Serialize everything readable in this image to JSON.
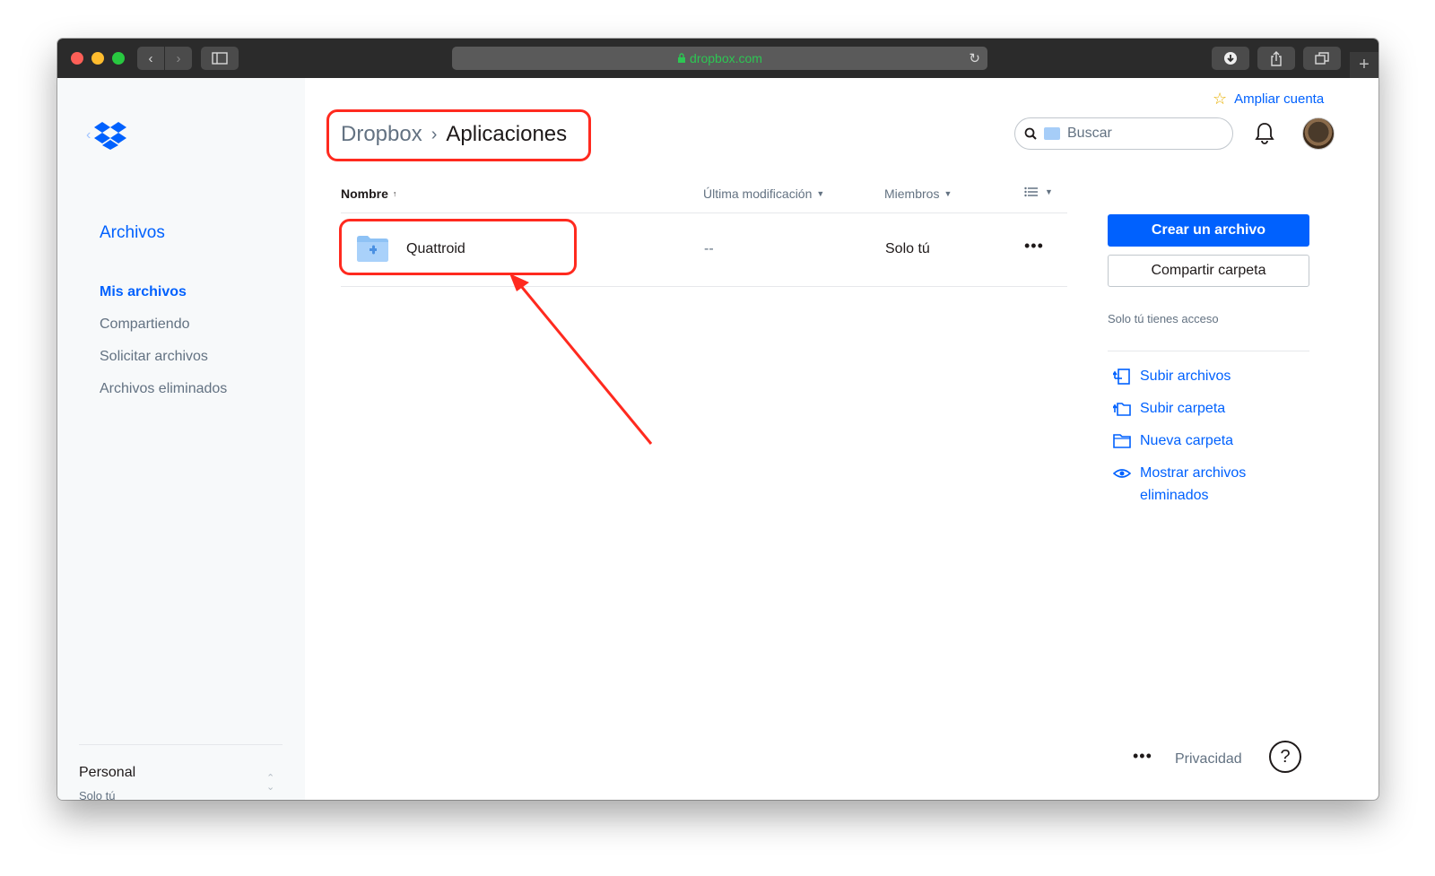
{
  "browser": {
    "url": "dropbox.com",
    "back_glyph": "‹",
    "forward_glyph": "›",
    "reload_glyph": "↻",
    "newtab_glyph": "+"
  },
  "sidebar": {
    "title": "Archivos",
    "items": [
      {
        "label": "Mis archivos",
        "active": true
      },
      {
        "label": "Compartiendo",
        "active": false
      },
      {
        "label": "Solicitar archivos",
        "active": false
      },
      {
        "label": "Archivos eliminados",
        "active": false
      }
    ],
    "account": {
      "name": "Personal",
      "sub": "Solo tú"
    }
  },
  "breadcrumb": {
    "root": "Dropbox",
    "separator": "›",
    "current": "Aplicaciones"
  },
  "header": {
    "upgrade_label": "Ampliar cuenta",
    "search_placeholder": "Buscar"
  },
  "table": {
    "columns": {
      "name": "Nombre",
      "modified": "Última modificación",
      "members": "Miembros"
    },
    "rows": [
      {
        "name": "Quattroid",
        "modified": "--",
        "members": "Solo tú",
        "more": "•••"
      }
    ]
  },
  "right_panel": {
    "primary_button": "Crear un archivo",
    "secondary_button": "Compartir carpeta",
    "access_note": "Solo tú tienes acceso",
    "actions": [
      {
        "label": "Subir archivos",
        "icon": "upload-files-icon"
      },
      {
        "label": "Subir carpeta",
        "icon": "upload-folder-icon"
      },
      {
        "label": "Nueva carpeta",
        "icon": "new-folder-icon"
      },
      {
        "label": "Mostrar archivos eliminados",
        "icon": "eye-icon"
      }
    ]
  },
  "footer": {
    "more": "•••",
    "privacy": "Privacidad",
    "help": "?"
  },
  "colors": {
    "accent": "#0061fe",
    "highlight": "#ff2a1f",
    "sidebar_bg": "#f7f9fa"
  }
}
